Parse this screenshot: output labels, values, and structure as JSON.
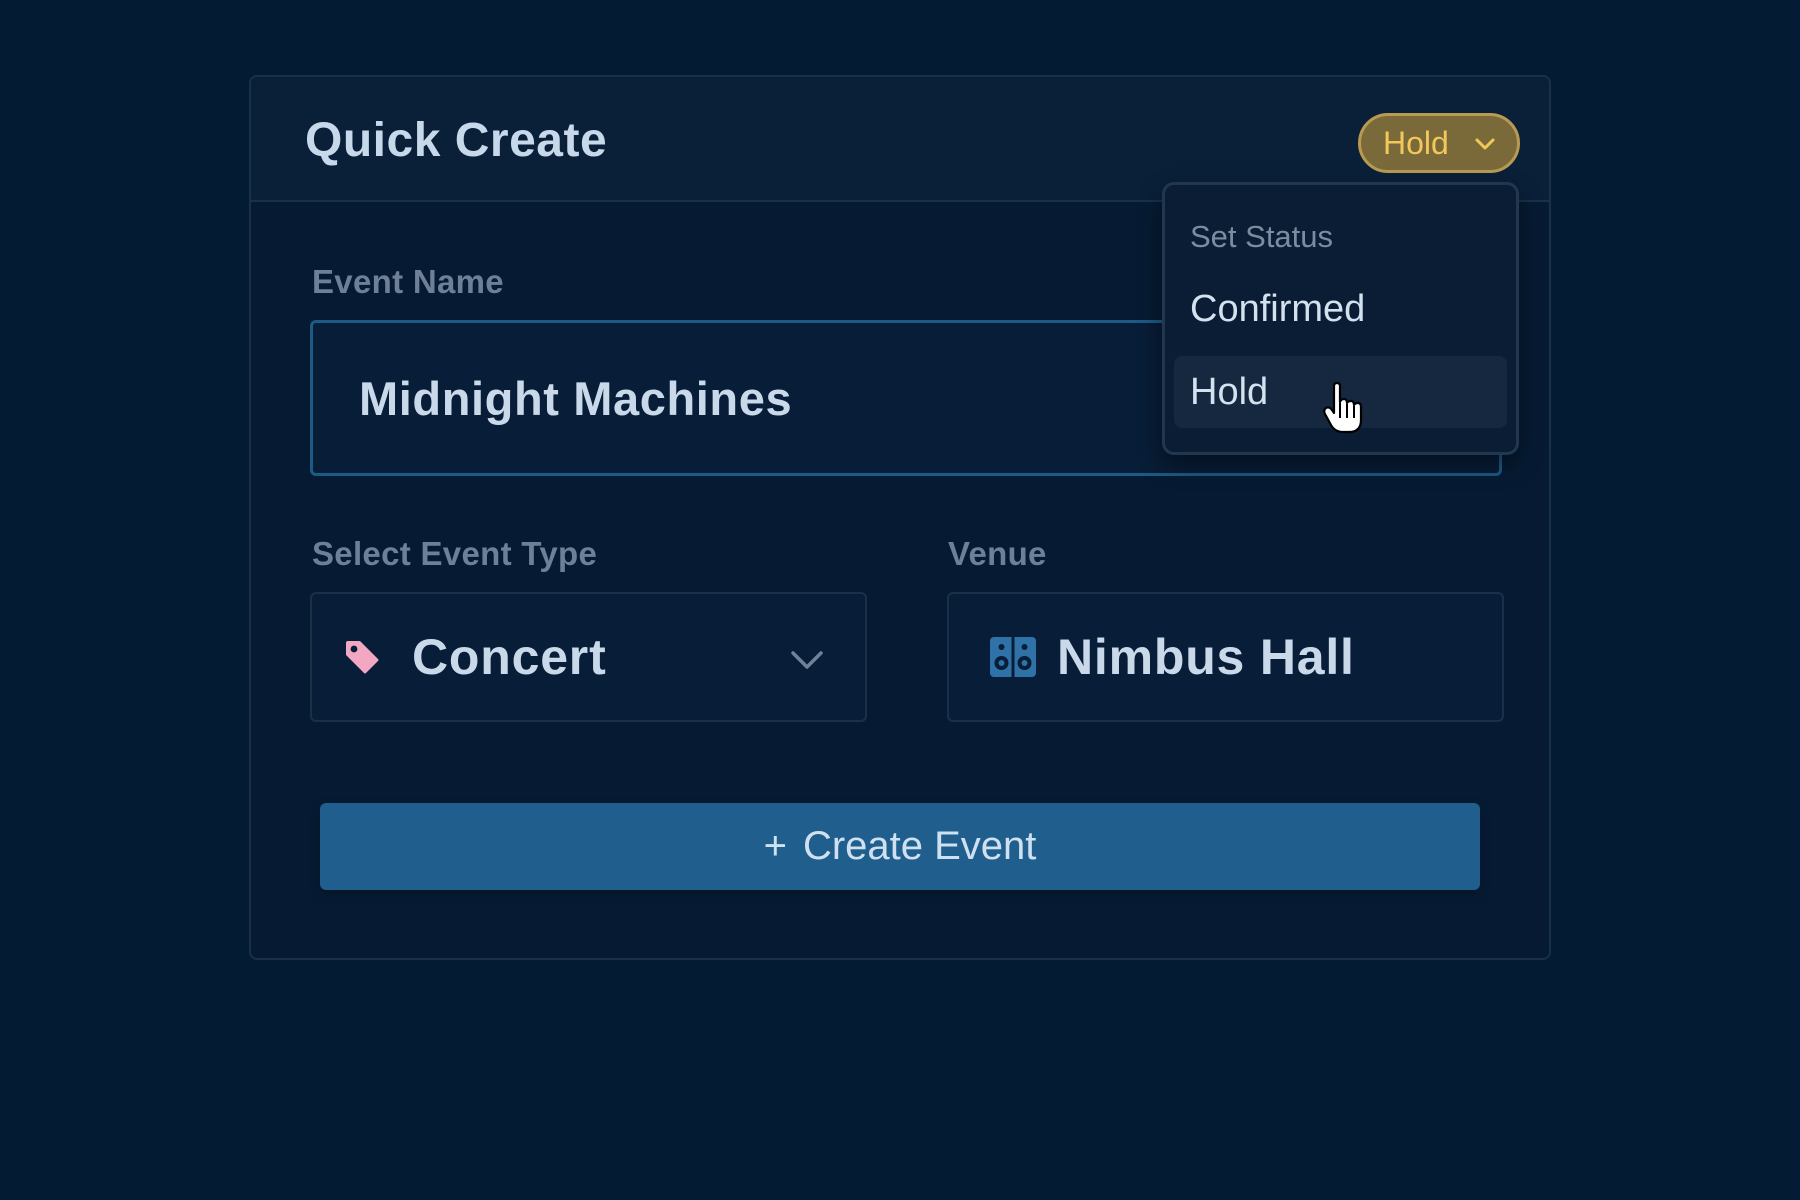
{
  "card": {
    "title": "Quick Create",
    "status": {
      "current": "Hold",
      "color": "#f3c85a"
    }
  },
  "event_name": {
    "label": "Event Name",
    "value": "Midnight Machines"
  },
  "event_type": {
    "label": "Select Event Type",
    "value": "Concert",
    "icon": "tag-icon",
    "icon_color": "#f2a7c3"
  },
  "venue": {
    "label": "Venue",
    "value": "Nimbus Hall",
    "icon": "speaker-icon",
    "icon_color": "#2f72a8"
  },
  "create_button": {
    "plus": "+",
    "label": "Create Event"
  },
  "status_menu": {
    "heading": "Set Status",
    "items": [
      {
        "label": "Confirmed"
      },
      {
        "label": "Hold",
        "selected": true
      }
    ]
  }
}
